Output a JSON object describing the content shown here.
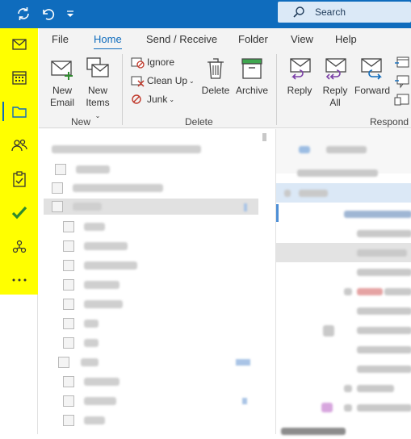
{
  "titlebar": {
    "search_placeholder": "Search",
    "icons": [
      "sync-icon",
      "undo-icon",
      "customize-quick-access-icon",
      "search-icon"
    ],
    "accent": "#0f6cbd"
  },
  "navrail": {
    "background": "#ffff00",
    "items": [
      "mail-icon",
      "calendar-icon",
      "folder-icon",
      "people-icon",
      "tasks-icon",
      "todo-check-icon",
      "groups-icon",
      "more-icon"
    ],
    "active": "folder-icon"
  },
  "tabs": [
    "File",
    "Home",
    "Send / Receive",
    "Folder",
    "View",
    "Help"
  ],
  "active_tab": "Home",
  "ribbon": {
    "new_group": {
      "label": "New",
      "new_email_line1": "New",
      "new_email_line2": "Email",
      "new_items_line1": "New",
      "new_items_line2": "Items"
    },
    "delete_group": {
      "label": "Delete",
      "ignore": "Ignore",
      "clean_up": "Clean Up",
      "junk": "Junk",
      "delete": "Delete",
      "archive": "Archive"
    },
    "respond_group": {
      "label": "Respond",
      "reply": "Reply",
      "reply_all_line1": "Reply",
      "reply_all_line2": "All",
      "forward": "Forward"
    }
  }
}
